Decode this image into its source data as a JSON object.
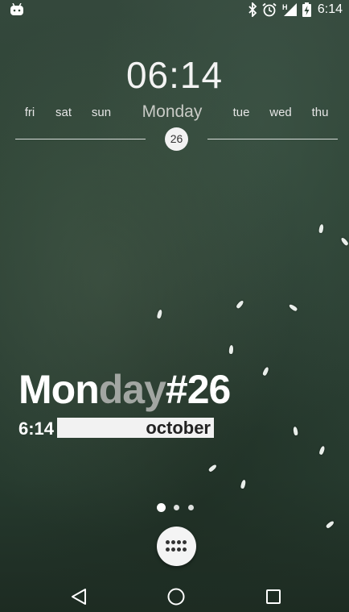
{
  "status_bar": {
    "time": "6:14",
    "icons": [
      "android-notification-icon",
      "bluetooth-icon",
      "alarm-icon",
      "signal-h-icon",
      "battery-charging-icon"
    ],
    "network_type": "H"
  },
  "clock_widget": {
    "time": "06:14",
    "days": {
      "fri": "fri",
      "sat": "sat",
      "sun": "sun",
      "current": "Monday",
      "tue": "tue",
      "wed": "wed",
      "thu": "thu"
    },
    "date": "26"
  },
  "date_widget": {
    "part_a": "Mon",
    "part_b": "day",
    "part_c": "#26",
    "time": "6:14",
    "month": "october"
  },
  "home": {
    "page_count": 3,
    "current_page": 1,
    "app_drawer_icon": "apps-grid-icon"
  },
  "nav_bar": {
    "back": "back-icon",
    "home": "home-icon",
    "recents": "recents-icon"
  },
  "colors": {
    "background": "#2e4436",
    "accent_white": "#ffffff",
    "muted": "#a2a6a2"
  }
}
